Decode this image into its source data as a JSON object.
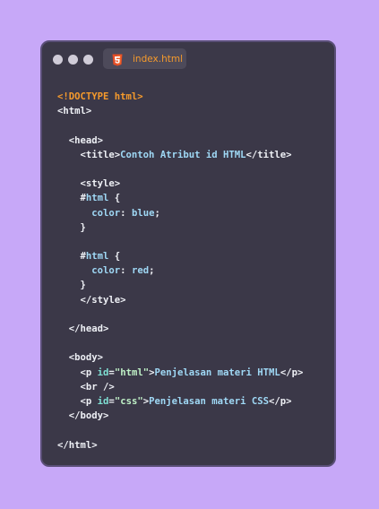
{
  "window": {
    "tab_label": "index.html",
    "tab_icon": "html5-icon"
  },
  "code_lines": [
    {
      "indent": "",
      "tokens": [
        {
          "t": "<!DOCTYPE html>",
          "c": "doctype"
        }
      ]
    },
    {
      "indent": "",
      "tokens": [
        {
          "t": "<html>",
          "c": "tag"
        }
      ]
    },
    {
      "indent": "",
      "tokens": []
    },
    {
      "indent": "  ",
      "tokens": [
        {
          "t": "<head>",
          "c": "tag"
        }
      ]
    },
    {
      "indent": "    ",
      "tokens": [
        {
          "t": "<title>",
          "c": "tag"
        },
        {
          "t": "Contoh Atribut id HTML",
          "c": "text"
        },
        {
          "t": "</title>",
          "c": "tag"
        }
      ]
    },
    {
      "indent": "",
      "tokens": []
    },
    {
      "indent": "    ",
      "tokens": [
        {
          "t": "<style>",
          "c": "tag"
        }
      ]
    },
    {
      "indent": "    ",
      "tokens": [
        {
          "t": "#",
          "c": "punct"
        },
        {
          "t": "html",
          "c": "sel"
        },
        {
          "t": " {",
          "c": "punct"
        }
      ]
    },
    {
      "indent": "      ",
      "tokens": [
        {
          "t": "color",
          "c": "prop"
        },
        {
          "t": ": ",
          "c": "punct"
        },
        {
          "t": "blue",
          "c": "val"
        },
        {
          "t": ";",
          "c": "punct"
        }
      ]
    },
    {
      "indent": "    ",
      "tokens": [
        {
          "t": "}",
          "c": "punct"
        }
      ]
    },
    {
      "indent": "",
      "tokens": []
    },
    {
      "indent": "    ",
      "tokens": [
        {
          "t": "#",
          "c": "punct"
        },
        {
          "t": "html",
          "c": "sel"
        },
        {
          "t": " {",
          "c": "punct"
        }
      ]
    },
    {
      "indent": "      ",
      "tokens": [
        {
          "t": "color",
          "c": "prop"
        },
        {
          "t": ": ",
          "c": "punct"
        },
        {
          "t": "red",
          "c": "val"
        },
        {
          "t": ";",
          "c": "punct"
        }
      ]
    },
    {
      "indent": "    ",
      "tokens": [
        {
          "t": "}",
          "c": "punct"
        }
      ]
    },
    {
      "indent": "    ",
      "tokens": [
        {
          "t": "</style>",
          "c": "tag"
        }
      ]
    },
    {
      "indent": "",
      "tokens": []
    },
    {
      "indent": "  ",
      "tokens": [
        {
          "t": "</head>",
          "c": "tag"
        }
      ]
    },
    {
      "indent": "",
      "tokens": []
    },
    {
      "indent": "  ",
      "tokens": [
        {
          "t": "<body>",
          "c": "tag"
        }
      ]
    },
    {
      "indent": "    ",
      "tokens": [
        {
          "t": "<p ",
          "c": "tag"
        },
        {
          "t": "id",
          "c": "attr"
        },
        {
          "t": "=",
          "c": "punct"
        },
        {
          "t": "\"html\"",
          "c": "str"
        },
        {
          "t": ">",
          "c": "tag"
        },
        {
          "t": "Penjelasan materi HTML",
          "c": "text"
        },
        {
          "t": "</p>",
          "c": "tag"
        }
      ]
    },
    {
      "indent": "    ",
      "tokens": [
        {
          "t": "<br />",
          "c": "tag"
        }
      ]
    },
    {
      "indent": "    ",
      "tokens": [
        {
          "t": "<p ",
          "c": "tag"
        },
        {
          "t": "id",
          "c": "attr"
        },
        {
          "t": "=",
          "c": "punct"
        },
        {
          "t": "\"css\"",
          "c": "str"
        },
        {
          "t": ">",
          "c": "tag"
        },
        {
          "t": "Penjelasan materi CSS",
          "c": "text"
        },
        {
          "t": "</p>",
          "c": "tag"
        }
      ]
    },
    {
      "indent": "  ",
      "tokens": [
        {
          "t": "</body>",
          "c": "tag"
        }
      ]
    },
    {
      "indent": "",
      "tokens": []
    },
    {
      "indent": "",
      "tokens": [
        {
          "t": "</html>",
          "c": "tag"
        }
      ]
    }
  ],
  "colors": {
    "background": "#c7a8f8",
    "window_bg": "#3b3848",
    "window_border": "#5a4f77",
    "accent_orange": "#f59a2c"
  }
}
